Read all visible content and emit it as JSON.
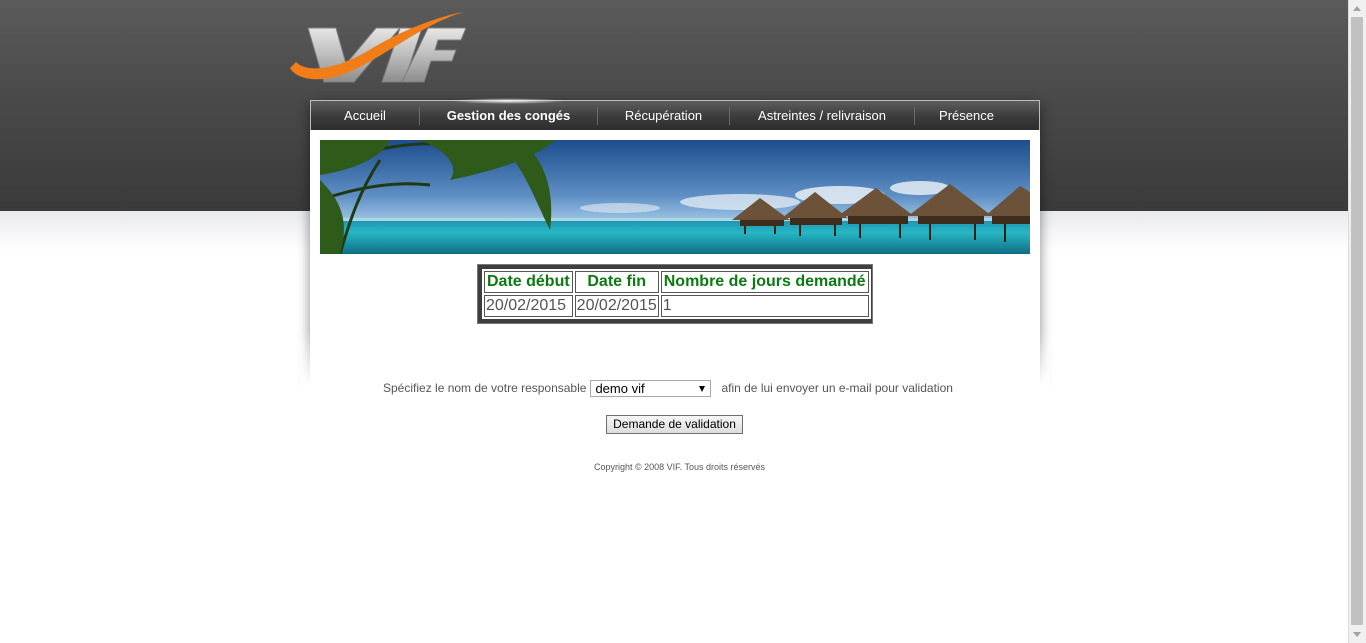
{
  "brand": {
    "logo_text": "VIF"
  },
  "nav": {
    "items": [
      {
        "label": "Accueil",
        "active": false
      },
      {
        "label": "Gestion des congés",
        "active": true
      },
      {
        "label": "Récupération",
        "active": false
      },
      {
        "label": "Astreintes / relivraison",
        "active": false
      },
      {
        "label": "Présence",
        "active": false
      }
    ]
  },
  "table": {
    "headers": [
      "Date début",
      "Date fin",
      "Nombre de jours demandé"
    ],
    "rows": [
      [
        "20/02/2015",
        "20/02/2015",
        "1"
      ]
    ]
  },
  "form": {
    "label_before": "Spécifiez le nom de votre responsable",
    "selected_manager": "demo vif",
    "label_after": "afin de lui envoyer un e-mail pour validation",
    "submit_label": "Demande de validation"
  },
  "footer": {
    "copyright": "Copyright © 2008 VIF. Tous droits réservés"
  },
  "colors": {
    "header_dark": "#3a3a3a",
    "table_header_text": "#0b7a10",
    "logo_orange": "#f07d18",
    "logo_silver": "#b8b8b8"
  }
}
